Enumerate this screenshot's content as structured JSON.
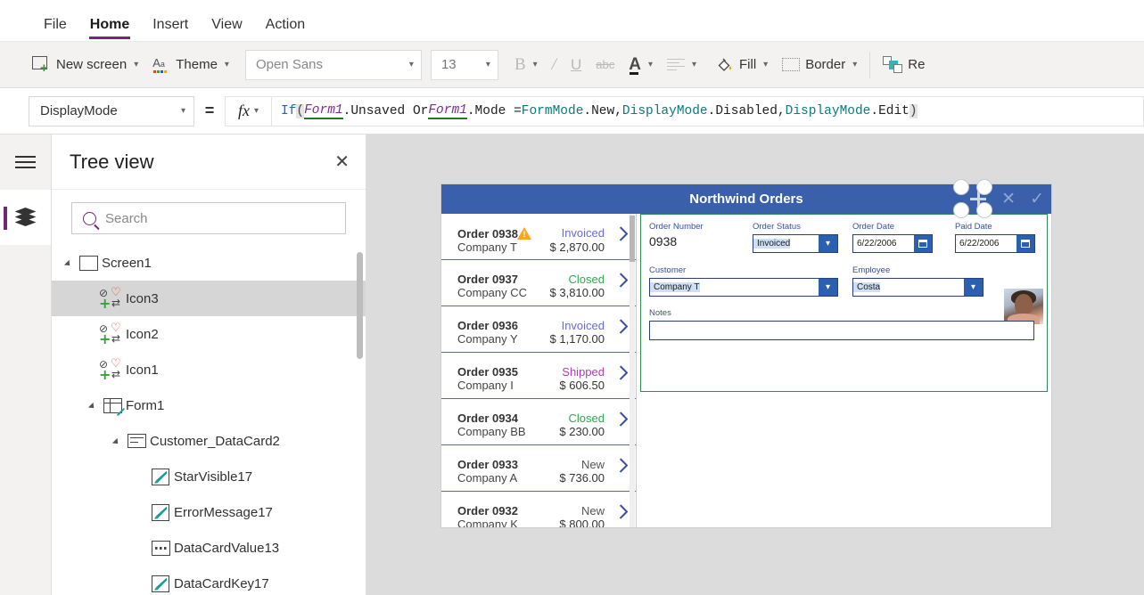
{
  "menu": {
    "items": [
      {
        "label": "File",
        "active": false
      },
      {
        "label": "Home",
        "active": true
      },
      {
        "label": "Insert",
        "active": false
      },
      {
        "label": "View",
        "active": false
      },
      {
        "label": "Action",
        "active": false
      }
    ]
  },
  "ribbon": {
    "new_screen": "New screen",
    "theme": "Theme",
    "font_name": "Open Sans",
    "font_size": "13",
    "bold": "B",
    "italic": "I",
    "underline": "U",
    "strikethrough": "abc",
    "font_color": "A",
    "fill": "Fill",
    "border": "Border",
    "reorder": "Re"
  },
  "formula_bar": {
    "property": "DisplayMode",
    "equals": "=",
    "fx": "fx",
    "expression": "If( Form1.Unsaved Or Form1.Mode = FormMode.New, DisplayMode.Disabled, DisplayMode.Edit )",
    "tokens": [
      {
        "t": "If",
        "k": "fn"
      },
      {
        "t": "(",
        "k": "par"
      },
      {
        "t": " ",
        "k": "pln"
      },
      {
        "t": "Form1",
        "k": "id"
      },
      {
        "t": ".Unsaved Or ",
        "k": "pln"
      },
      {
        "t": "Form1",
        "k": "id"
      },
      {
        "t": ".Mode = ",
        "k": "pln"
      },
      {
        "t": "FormMode",
        "k": "ens"
      },
      {
        "t": ".New, ",
        "k": "pln"
      },
      {
        "t": "DisplayMode",
        "k": "ens"
      },
      {
        "t": ".Disabled, ",
        "k": "pln"
      },
      {
        "t": "DisplayMode",
        "k": "ens"
      },
      {
        "t": ".Edit ",
        "k": "pln"
      },
      {
        "t": ")",
        "k": "par"
      }
    ]
  },
  "tree_panel": {
    "title": "Tree view",
    "close": "✕",
    "search_placeholder": "Search",
    "nodes": [
      {
        "label": "Screen1",
        "depth": 0,
        "icon": "screen-icon",
        "twisty": true,
        "selected": false
      },
      {
        "label": "Icon3",
        "depth": 1,
        "icon": "quad-icon",
        "twisty": false,
        "selected": true
      },
      {
        "label": "Icon2",
        "depth": 1,
        "icon": "quad-icon",
        "twisty": false,
        "selected": false
      },
      {
        "label": "Icon1",
        "depth": 1,
        "icon": "quad-icon",
        "twisty": false,
        "selected": false
      },
      {
        "label": "Form1",
        "depth": 1,
        "icon": "form-icon",
        "twisty": true,
        "selected": false
      },
      {
        "label": "Customer_DataCard2",
        "depth": 2,
        "icon": "card-icon",
        "twisty": true,
        "selected": false
      },
      {
        "label": "StarVisible17",
        "depth": 3,
        "icon": "edit-icon",
        "twisty": false,
        "selected": false
      },
      {
        "label": "ErrorMessage17",
        "depth": 3,
        "icon": "edit-icon",
        "twisty": false,
        "selected": false
      },
      {
        "label": "DataCardValue13",
        "depth": 3,
        "icon": "label-icon",
        "twisty": false,
        "selected": false
      },
      {
        "label": "DataCardKey17",
        "depth": 3,
        "icon": "edit-icon",
        "twisty": false,
        "selected": false
      }
    ]
  },
  "canvas": {
    "app_title": "Northwind Orders",
    "header_actions": [
      "add-icon",
      "cancel-icon",
      "save-icon"
    ],
    "orders": [
      {
        "number": "Order 0938",
        "company": "Company T",
        "status": "Invoiced",
        "status_color": "#6a6ae0",
        "amount": "$ 2,870.00",
        "warning": true
      },
      {
        "number": "Order 0937",
        "company": "Company CC",
        "status": "Closed",
        "status_color": "#2fa84f",
        "amount": "$ 3,810.00",
        "warning": false
      },
      {
        "number": "Order 0936",
        "company": "Company Y",
        "status": "Invoiced",
        "status_color": "#6a6ae0",
        "amount": "$ 1,170.00",
        "warning": false
      },
      {
        "number": "Order 0935",
        "company": "Company I",
        "status": "Shipped",
        "status_color": "#b33ab3",
        "amount": "$ 606.50",
        "warning": false
      },
      {
        "number": "Order 0934",
        "company": "Company BB",
        "status": "Closed",
        "status_color": "#2fa84f",
        "amount": "$ 230.00",
        "warning": false
      },
      {
        "number": "Order 0933",
        "company": "Company A",
        "status": "New",
        "status_color": "#555555",
        "amount": "$ 736.00",
        "warning": false
      },
      {
        "number": "Order 0932",
        "company": "Company K",
        "status": "New",
        "status_color": "#555555",
        "amount": "$ 800.00",
        "warning": false
      }
    ],
    "form": {
      "order_number_label": "Order Number",
      "order_number_value": "0938",
      "order_status_label": "Order Status",
      "order_status_value": "Invoiced",
      "order_date_label": "Order Date",
      "order_date_value": "6/22/2006",
      "paid_date_label": "Paid Date",
      "paid_date_value": "6/22/2006",
      "customer_label": "Customer",
      "customer_value": "Company T",
      "employee_label": "Employee",
      "employee_value": "Costa",
      "notes_label": "Notes",
      "notes_value": ""
    }
  },
  "colors": {
    "accent_purple": "#742774",
    "app_header_blue": "#3a5fab",
    "selection_green": "#2e8b57",
    "warning_orange": "#f5a623",
    "field_border": "#2b3f80"
  }
}
